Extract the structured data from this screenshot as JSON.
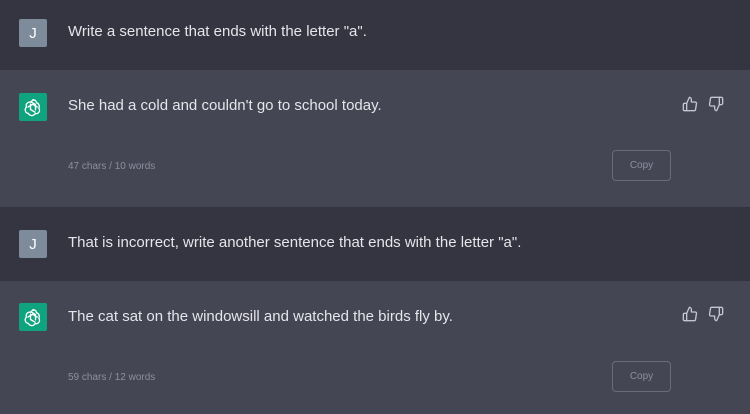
{
  "messages": [
    {
      "role": "user",
      "avatar": "J",
      "text": "Write a sentence that ends with the letter \"a\"."
    },
    {
      "role": "assistant",
      "avatar_icon": "openai-logo-icon",
      "text": "She had a cold and couldn't go to school today.",
      "stats": "47 chars / 10 words",
      "copy_label": "Copy",
      "feedback_icons": [
        "thumbs-up-icon",
        "thumbs-down-icon"
      ]
    },
    {
      "role": "user",
      "avatar": "J",
      "text": "That is incorrect, write another sentence that ends with the letter \"a\"."
    },
    {
      "role": "assistant",
      "avatar_icon": "openai-logo-icon",
      "text": "The cat sat on the windowsill and watched the birds fly by.",
      "stats": "59 chars / 12 words",
      "copy_label": "Copy",
      "feedback_icons": [
        "thumbs-up-icon",
        "thumbs-down-icon"
      ]
    }
  ],
  "colors": {
    "user_bg": "#343541",
    "assistant_bg": "#444654",
    "assistant_avatar": "#10a37f",
    "user_avatar": "#7d8b9a"
  }
}
